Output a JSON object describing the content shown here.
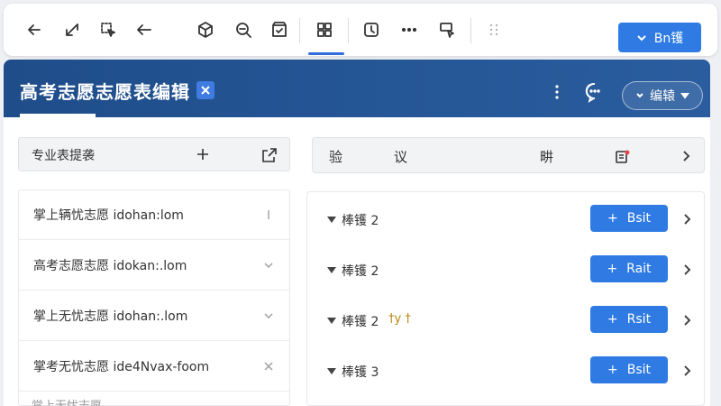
{
  "toolbar": {
    "icons": [
      "arrow-left-icon",
      "resize-icon",
      "cursor-select-icon",
      "arrow-left-alt-icon",
      "cube-icon",
      "zoom-icon",
      "box-check-icon",
      "grid-icon",
      "timer-icon",
      "more-horizontal-icon",
      "select-tool-icon",
      "drag-handle-icon"
    ],
    "primary_label": "Bn镬"
  },
  "window": {
    "title": "高考志愿志愿表编辑",
    "edit_label": "编辕",
    "colors": {
      "header": "#1f4d8a",
      "accent": "#2f7be3"
    }
  },
  "left_panel": {
    "header_label": "专业表提袭",
    "items": [
      {
        "text": "掌上辆忧志愿 idohan:lom",
        "control": "divider"
      },
      {
        "text": "高考志愿志愿 idokan:.lom",
        "control": "chevron-down"
      },
      {
        "text": "掌上无忧志愿 idohan:.lom",
        "control": "chevron-down"
      },
      {
        "text": "掌考无忧志愿 ide4Nvax-foom",
        "control": "close"
      }
    ],
    "peek_text": "掌上无忧志愿"
  },
  "right_panel": {
    "header_cells": [
      "验",
      "议",
      "畊"
    ],
    "rows": [
      {
        "label": "棒镬 2",
        "extra": "",
        "button": "Bsit"
      },
      {
        "label": "棒镬 2",
        "extra": "",
        "button": "Rait"
      },
      {
        "label": "棒镬 2",
        "extra": "†y †",
        "button": "Rsit"
      },
      {
        "label": "棒镬 3",
        "extra": "",
        "button": "Bsit"
      }
    ]
  }
}
